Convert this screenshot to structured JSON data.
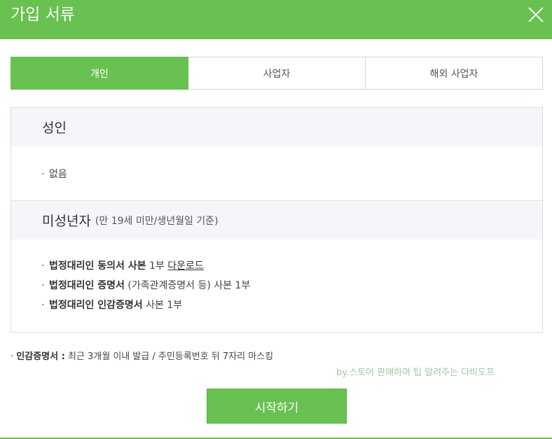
{
  "header": {
    "title": "가입 서류",
    "close_icon": "close-icon"
  },
  "tabs": [
    {
      "label": "개인",
      "active": true
    },
    {
      "label": "사업자",
      "active": false
    },
    {
      "label": "해외 사업자",
      "active": false
    }
  ],
  "adult": {
    "title": "성인",
    "items": [
      {
        "bullet": "·",
        "text": "없음"
      }
    ]
  },
  "minor": {
    "title": "미성년자",
    "note": "(만 19세 미만/생년월일 기준)",
    "items": [
      {
        "bullet": "·",
        "bold": "법정대리인 동의서 사본",
        "rest": " 1부 ",
        "link": "다운로드"
      },
      {
        "bullet": "·",
        "bold": "법정대리인 증명서",
        "rest": " (가족관계증명서 등) 사본 1부"
      },
      {
        "bullet": "·",
        "bold": "법정대리인 인감증명서",
        "rest": " 사본 1부"
      }
    ]
  },
  "footnote": {
    "bullet": "·",
    "bold": "인감증명서 :",
    "text": " 최근 3개월 이내 발급 / 주민등록번호 뒤 7자리 마스킹"
  },
  "watermark": "by.스토어 판매하며 팁 알려주는 다비도프",
  "start_button": "시작하기",
  "colors": {
    "accent": "#68c150",
    "section_bg": "#f5f6fa",
    "border": "#dcdcdc"
  }
}
